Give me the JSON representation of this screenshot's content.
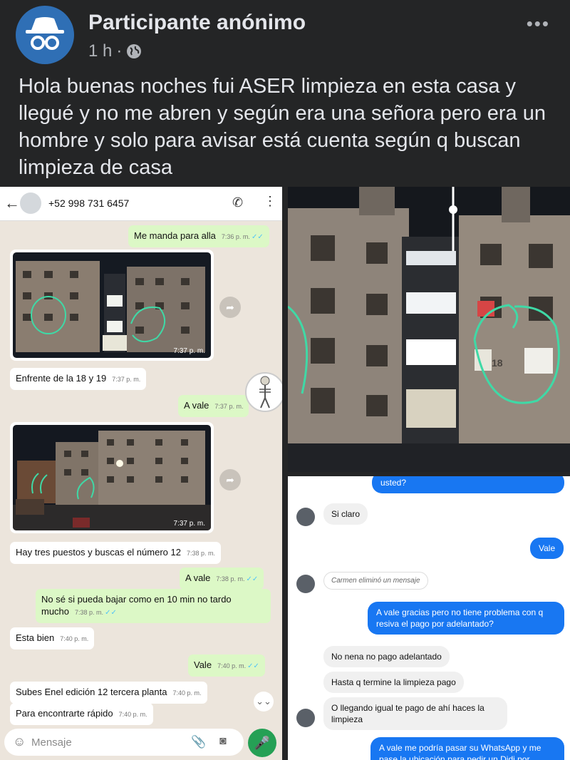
{
  "post": {
    "author": "Participante anónimo",
    "time": "1 h",
    "separator": "·",
    "more": "•••",
    "text": "Hola buenas noches fui ASER limpieza en esta casa y llegué y no me abren y según era una señora pero era un hombre y solo para avisar está cuenta según q buscan limpieza de casa",
    "icons": [
      "anonymous-avatar-icon",
      "globe-icon",
      "more-icon"
    ]
  },
  "whatsapp": {
    "back": "←",
    "phone": "+52 998 731 6457",
    "call_icon": "✆",
    "menu_icon": "⋮",
    "messages": [
      {
        "text": "Me manda para alla",
        "time": "7:36 p. m."
      },
      {
        "image_time": "7:37 p. m."
      },
      {
        "text": "Enfrente de la 18 y 19",
        "time": "7:37 p. m."
      },
      {
        "text": "A vale",
        "time": "7:37 p. m."
      },
      {
        "image_time": "7:37 p. m."
      },
      {
        "text": "Hay tres puestos y buscas el número 12",
        "time": "7:38 p. m."
      },
      {
        "text": "A vale",
        "time": "7:38 p. m."
      },
      {
        "text": "No sé si pueda bajar como en 10 min no tardo mucho",
        "time": "7:38 p. m."
      },
      {
        "text": "Esta bien",
        "time": "7:40 p. m."
      },
      {
        "text": "Vale",
        "time": "7:40 p. m."
      },
      {
        "text": "Subes Enel edición 12 tercera planta",
        "time": "7:40 p. m."
      },
      {
        "text": "Para encontrarte rápido",
        "time": "7:40 p. m."
      }
    ],
    "tick": "✓✓",
    "input_placeholder": "Mensaje",
    "scroll_icon": "⌄⌄"
  },
  "building_photo": {
    "number": "18"
  },
  "messenger": {
    "messages": [
      {
        "text": "usted?"
      },
      {
        "text": "Si claro"
      },
      {
        "text": "Vale"
      },
      {
        "text": "Carmen eliminó un mensaje"
      },
      {
        "text": "A vale gracias pero no tiene problema con q resiva el pago por adelantado?"
      },
      {
        "text": "No nena no pago adelantado"
      },
      {
        "text": "Hasta q termine la limpieza pago"
      },
      {
        "text": "O llegando igual te pago de ahí haces la limpieza"
      },
      {
        "text": "A vale me podría pasar su WhatsApp y me pase la ubicación para pedir un Didi por"
      }
    ]
  },
  "colors": {
    "fb_bg": "#242526",
    "fb_text": "#e4e6eb",
    "wa_bg": "#ece5dc",
    "wa_out": "#dcf8c6",
    "messenger_blue": "#1877f2",
    "circle_green": "#3fd9a6"
  }
}
